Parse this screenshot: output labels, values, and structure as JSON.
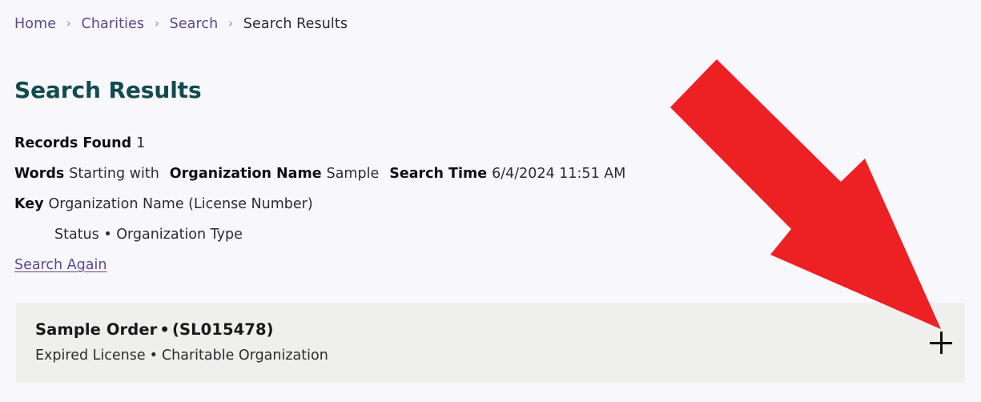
{
  "breadcrumb": {
    "separator": "›",
    "items": [
      {
        "label": "Home",
        "current": false
      },
      {
        "label": "Charities",
        "current": false
      },
      {
        "label": "Search",
        "current": false
      },
      {
        "label": "Search Results",
        "current": true
      }
    ]
  },
  "page": {
    "title": "Search Results"
  },
  "summary": {
    "records_found_label": "Records Found",
    "records_found_value": "1",
    "words_label": "Words",
    "words_value": "Starting with",
    "organization_name_label": "Organization Name",
    "organization_name_value": "Sample",
    "search_time_label": "Search Time",
    "search_time_value": "6/4/2024 11:51 AM",
    "key_label": "Key",
    "key_value": "Organization Name (License Number)",
    "key_value_line2": "Status • Organization Type",
    "search_again_label": "Search Again"
  },
  "results": [
    {
      "name": "Sample Order",
      "bullet": "•",
      "license_number": "(SL015478)",
      "status": "Expired License",
      "sub_bullet": "•",
      "organization_type": "Charitable Organization",
      "expand_icon": "plus-icon"
    }
  ],
  "annotation": {
    "arrow_icon": "red-arrow-pointing-down-right",
    "arrow_color": "#ED2024"
  },
  "colors": {
    "page_background": "#f8f7fc",
    "card_background": "#efefee",
    "link_purple": "#5b4a8f",
    "title_teal": "#114a4f",
    "annotation_red": "#ED2024"
  }
}
